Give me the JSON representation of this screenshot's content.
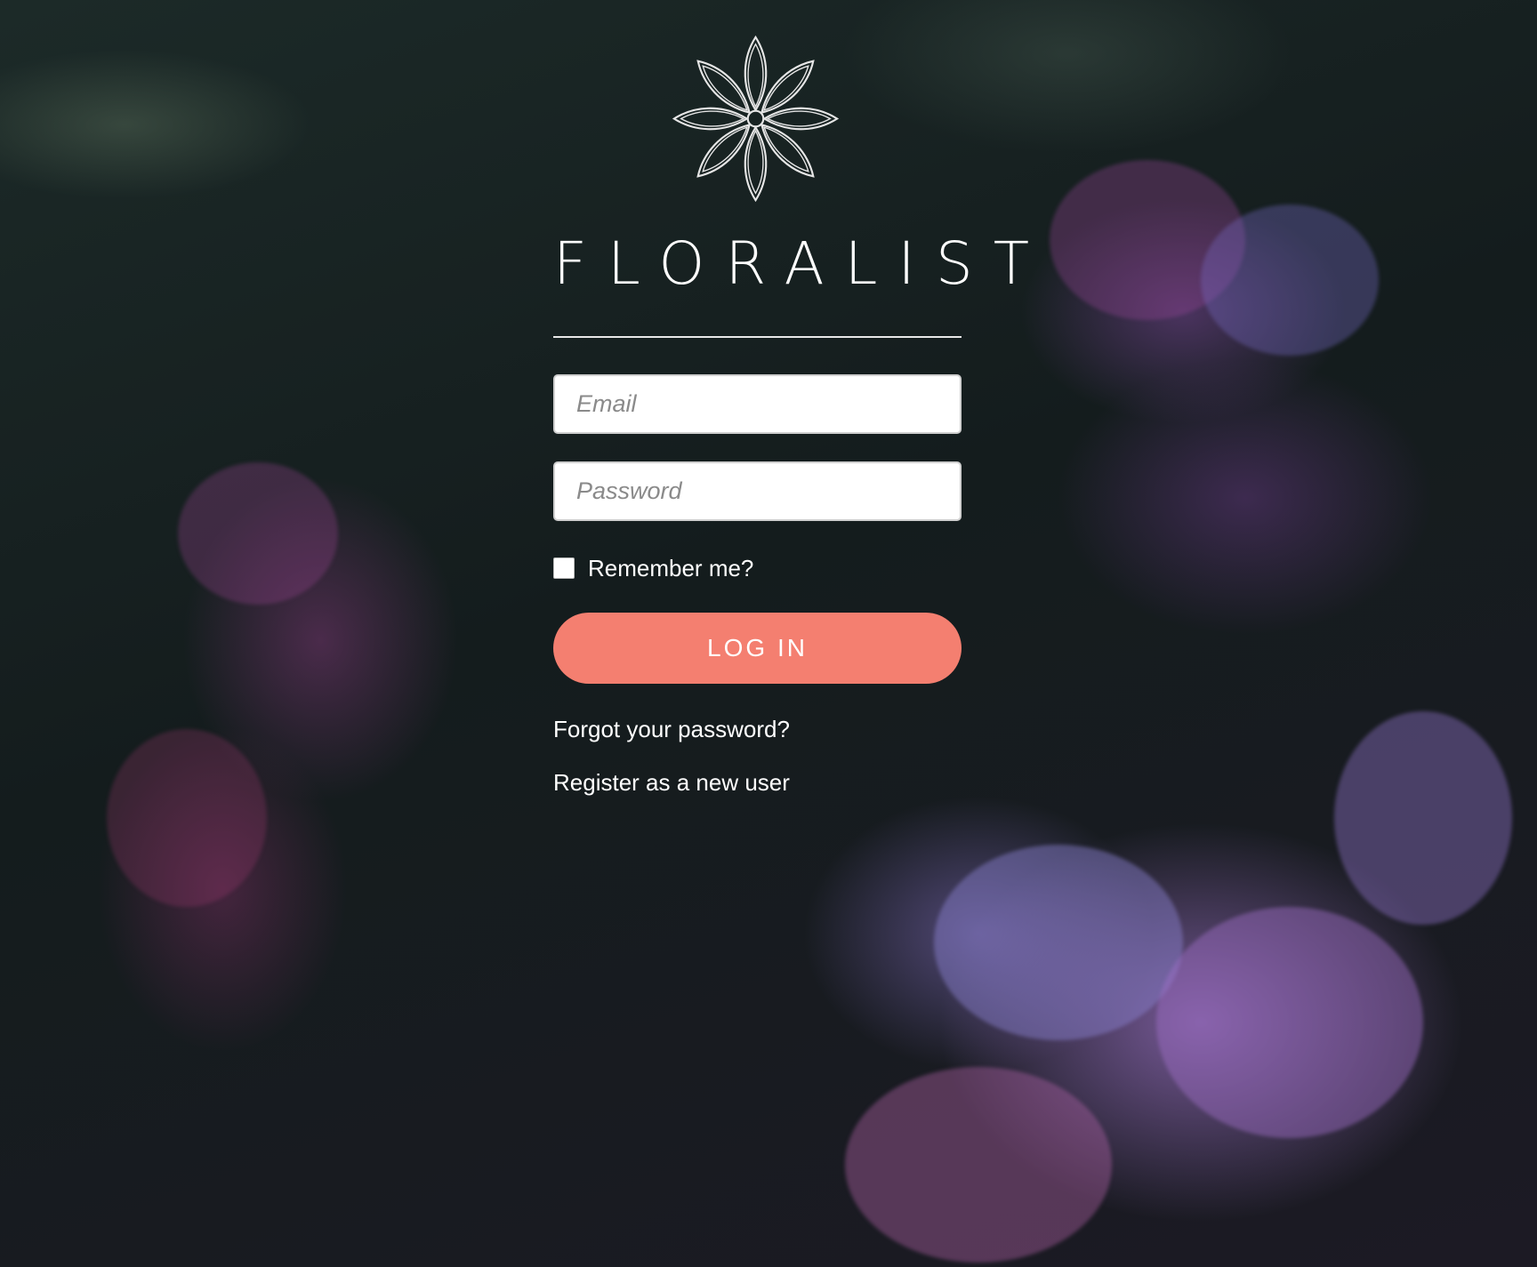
{
  "brand": {
    "name": "FLORALIST",
    "logo_icon": "flower-logo-icon"
  },
  "form": {
    "email_placeholder": "Email",
    "password_placeholder": "Password",
    "remember_label": "Remember me?",
    "remember_checked": false,
    "login_label": "LOG IN"
  },
  "links": {
    "forgot_password": "Forgot your password?",
    "register": "Register as a new user"
  },
  "colors": {
    "accent": "#f47f70",
    "background": "#1a2222",
    "text": "#ffffff"
  }
}
